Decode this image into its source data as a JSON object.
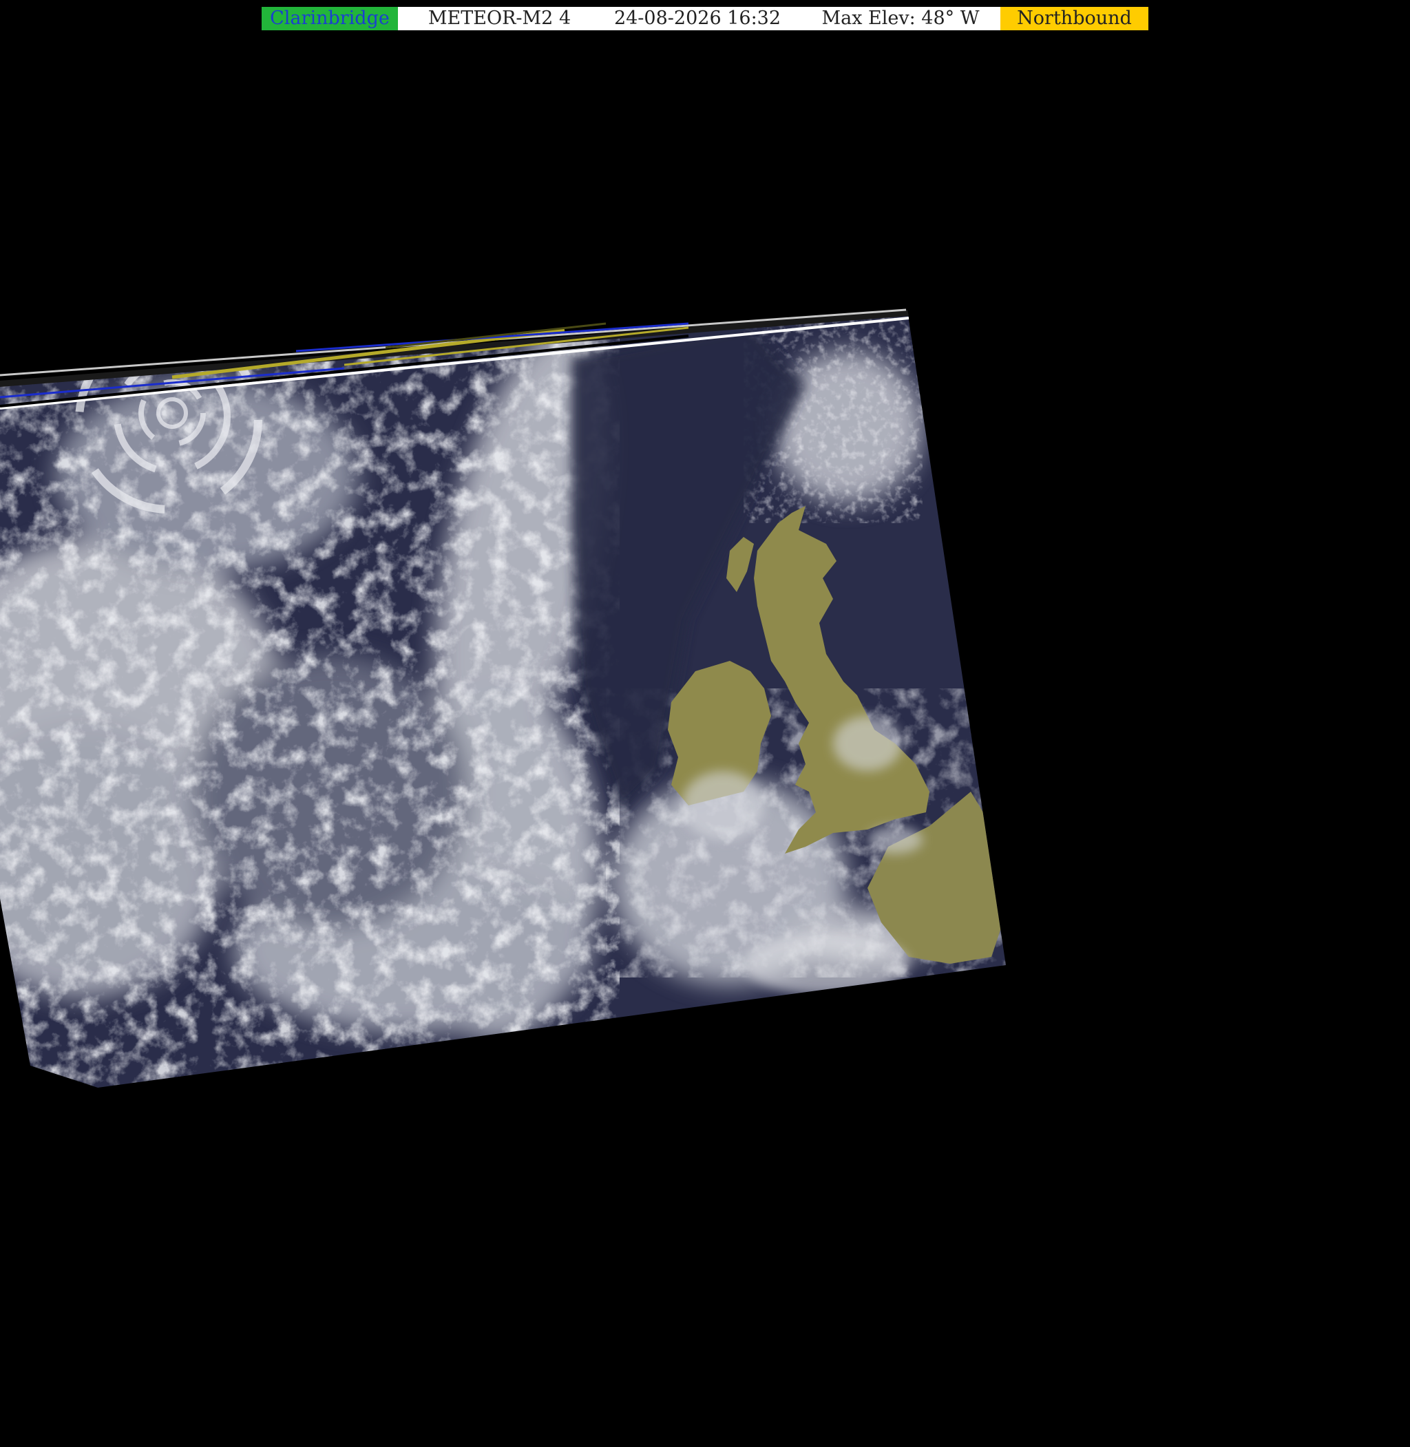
{
  "header": {
    "station": "Clarinbridge",
    "satellite": "METEOR-M2 4",
    "datetime": "24-08-2026 16:32",
    "max_elevation": "Max Elev: 48° W",
    "direction": "Northbound"
  },
  "colors": {
    "background": "#000000",
    "station_bg": "#22b53a",
    "station_text": "#1a3fd0",
    "direction_bg": "#ffcc00",
    "ocean": "#2a2d4a",
    "cloud": "#d8dae0",
    "land": "#8f8a4c"
  },
  "image": {
    "description_icon": "satellite-swath-image"
  }
}
